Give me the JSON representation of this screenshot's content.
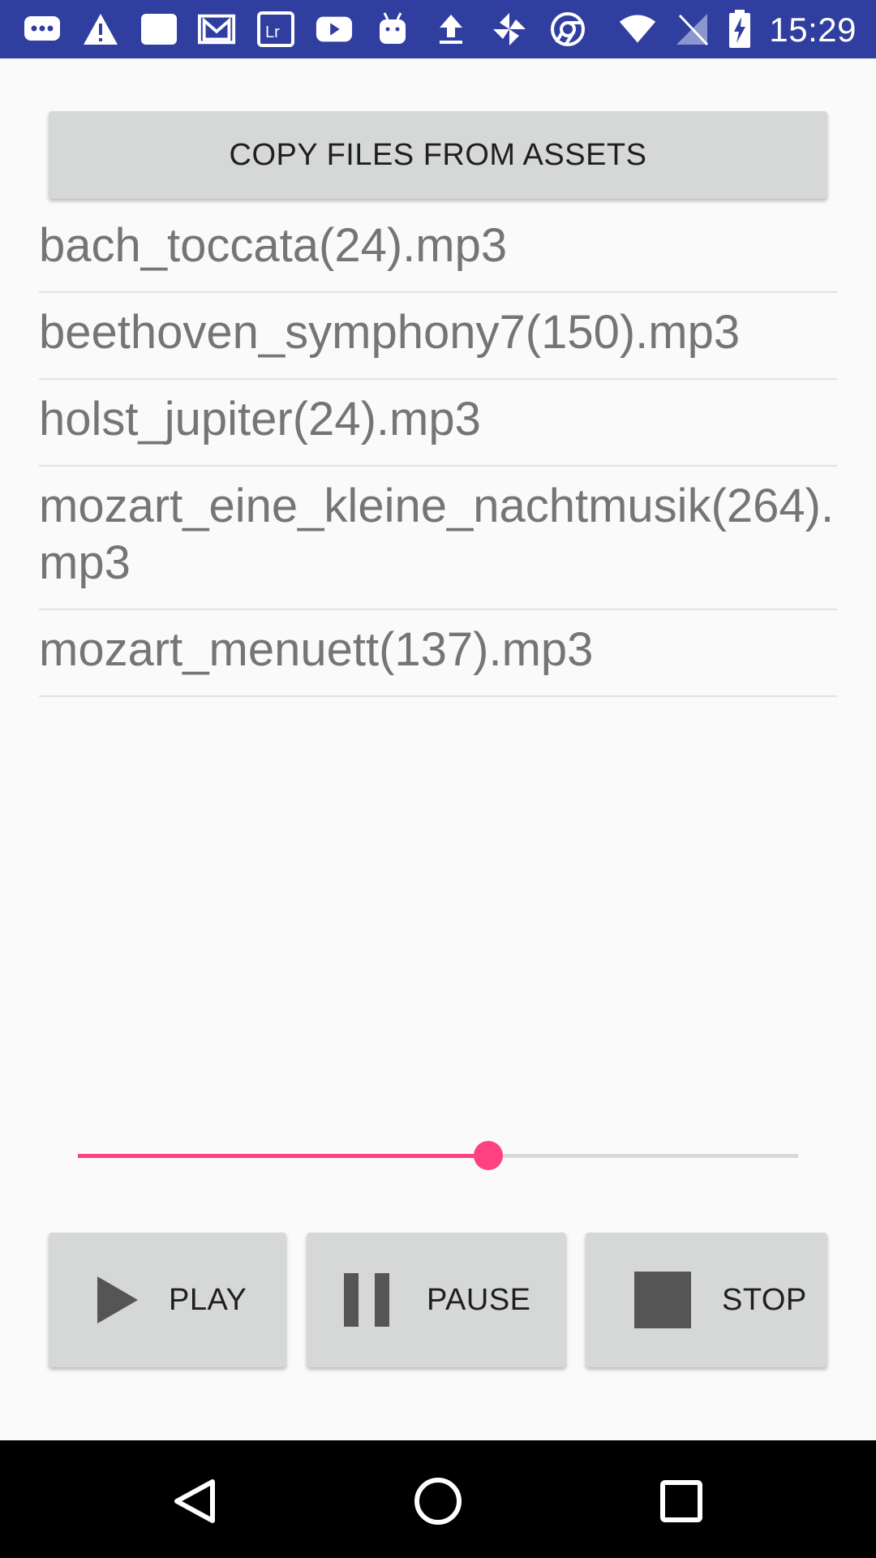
{
  "status_bar": {
    "time": "15:29",
    "icons": [
      "messages-icon",
      "warning-icon",
      "app-icon",
      "gmail-icon",
      "lightroom-icon",
      "youtube-icon",
      "android-debug-icon",
      "upload-icon",
      "pinwheel-icon",
      "chrome-icon",
      "wifi-icon",
      "no-signal-icon",
      "battery-charging-icon"
    ]
  },
  "copy_button": {
    "label": "COPY FILES FROM ASSETS"
  },
  "files": [
    "bach_toccata(24).mp3",
    "beethoven_symphony7(150).mp3",
    "holst_jupiter(24).mp3",
    "mozart_eine_kleine_nachtmusik(264).mp3",
    "mozart_menuett(137).mp3"
  ],
  "seekbar": {
    "progress": 0.57,
    "accent": "#ff4081",
    "track": "#d9d9d9"
  },
  "controls": {
    "play_label": "PLAY",
    "pause_label": "PAUSE",
    "stop_label": "STOP"
  },
  "nav": {
    "back": "back-icon",
    "home": "home-icon",
    "recents": "recents-icon"
  },
  "colors": {
    "status_bar": "#303f9f",
    "button_bg": "#d6d7d7",
    "list_text": "#757575"
  }
}
